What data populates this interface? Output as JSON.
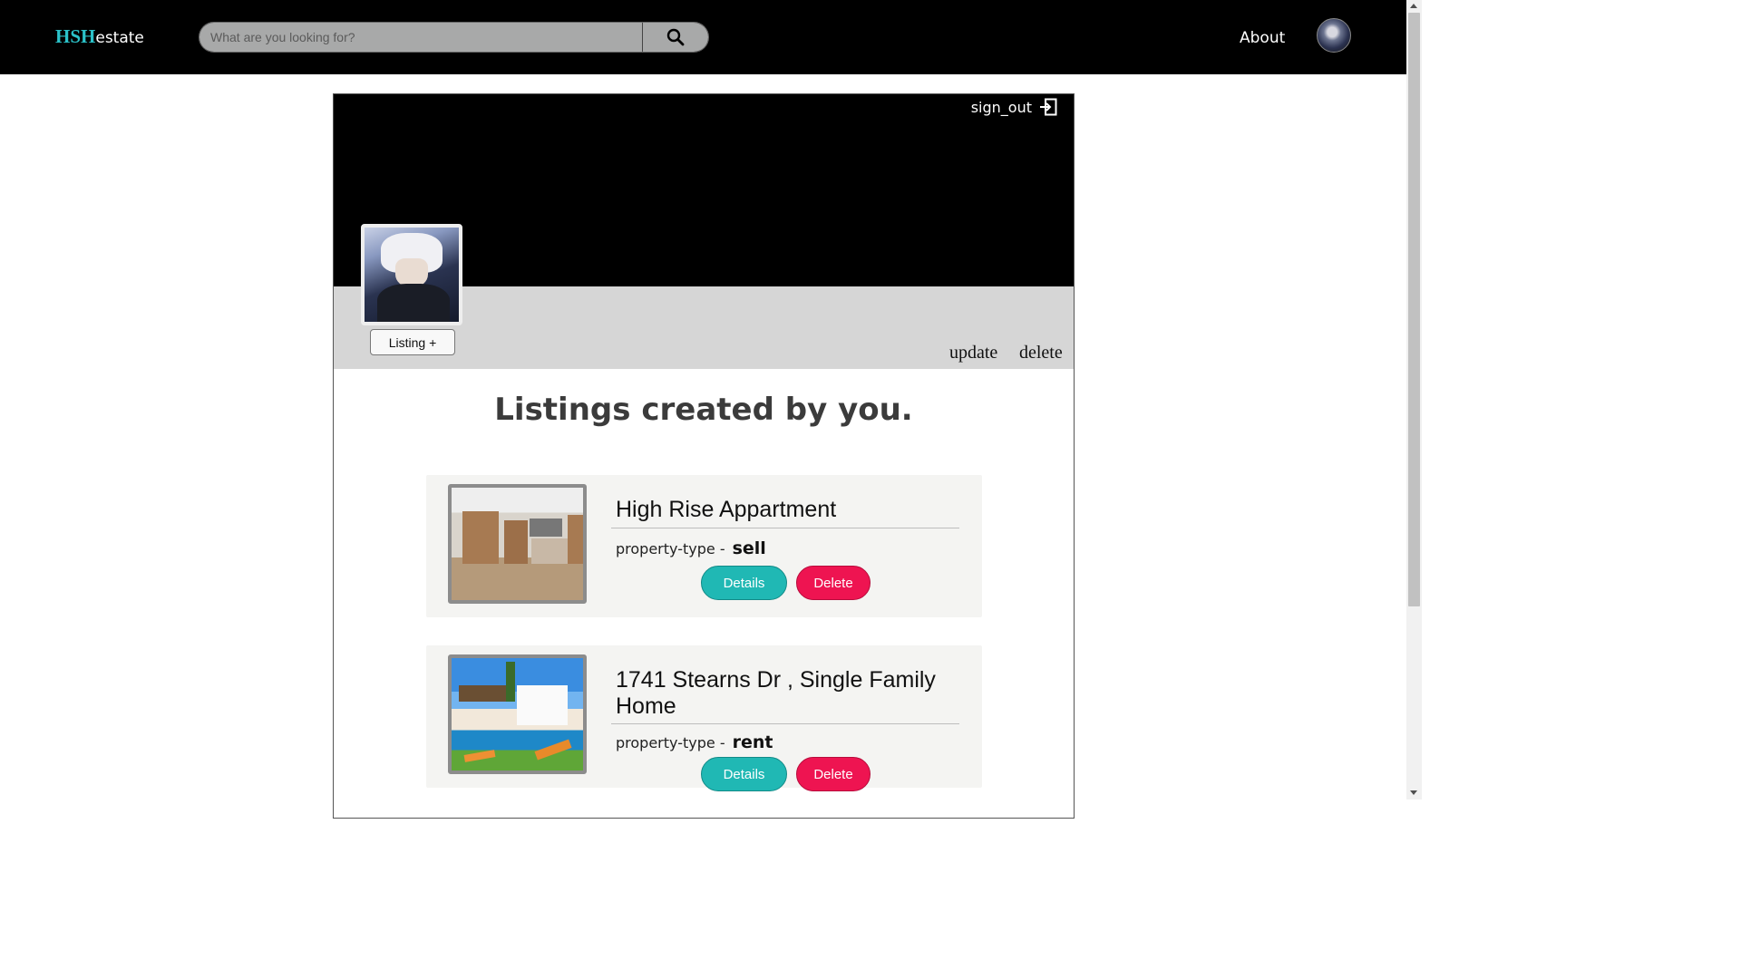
{
  "nav": {
    "logo_prefix": "HSH",
    "logo_suffix": "estate",
    "search_placeholder": "What are you looking for?",
    "about_label": "About"
  },
  "profile": {
    "signout_label": "sign_out",
    "listing_button": "Listing +",
    "update_label": "update",
    "delete_label": "delete",
    "heading": "Listings created by you."
  },
  "listings": [
    {
      "title": "High Rise Appartment",
      "type_label": "property-type -",
      "type_value": "sell",
      "details_label": "Details",
      "delete_label": "Delete"
    },
    {
      "title": "1741 Stearns Dr , Single Family Home",
      "type_label": "property-type -",
      "type_value": "rent",
      "details_label": "Details",
      "delete_label": "Delete"
    }
  ],
  "colors": {
    "accent": "#2bc2c9",
    "details_button": "#20b8b4",
    "delete_button": "#ee1451",
    "nav_bg": "#000000"
  }
}
